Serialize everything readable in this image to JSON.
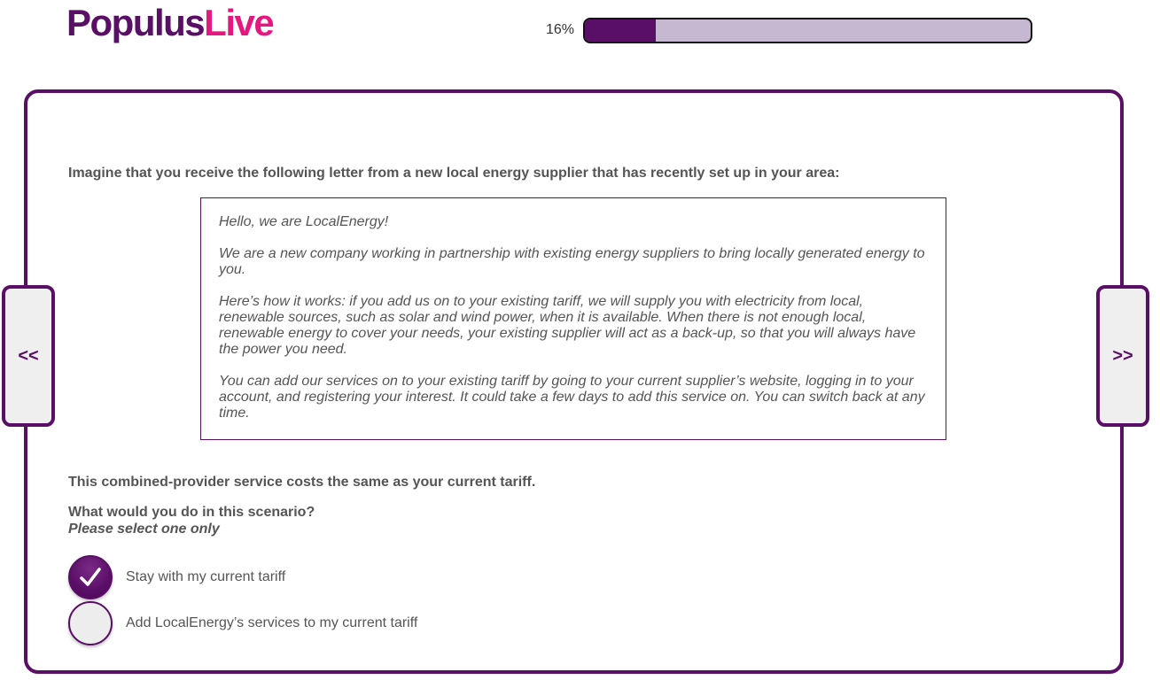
{
  "brand": {
    "name_part_a": "Populus",
    "name_part_b": "Live",
    "primary_color": "#5a0f66",
    "accent_color": "#e6177f"
  },
  "progress": {
    "label": "16%",
    "value_percent": 16
  },
  "navigation": {
    "prev_label": "<<",
    "next_label": ">>"
  },
  "survey": {
    "intro": "Imagine that you receive the following letter from a new local energy supplier that has recently set up in your area:",
    "letter": {
      "greeting": "Hello, we are LocalEnergy!",
      "paragraph_1": "We are a new company working in partnership with existing energy suppliers to bring locally generated energy to you.",
      "paragraph_2": "Here’s how it works: if you add us on to your existing tariff, we will supply you with electricity from local, renewable sources, such as solar and wind power, when it is available. When there is not enough local, renewable energy to cover your needs, your existing supplier will act as a back-up, so that you will always have the power you need.",
      "paragraph_3": "You can add our services on to your existing tariff by going to your current supplier’s website, logging in to your account, and registering your interest. It could take a few days to add this service on. You can switch back at any time."
    },
    "cost_note": "This combined-provider service costs the same as your current tariff.",
    "question": "What would you do in this scenario?",
    "instruction": "Please select one only",
    "options": [
      {
        "label": "Stay with my current tariff",
        "selected": true
      },
      {
        "label": "Add LocalEnergy’s services to my current tariff",
        "selected": false
      }
    ]
  },
  "icons": {
    "checkmark": "checkmark-icon"
  }
}
